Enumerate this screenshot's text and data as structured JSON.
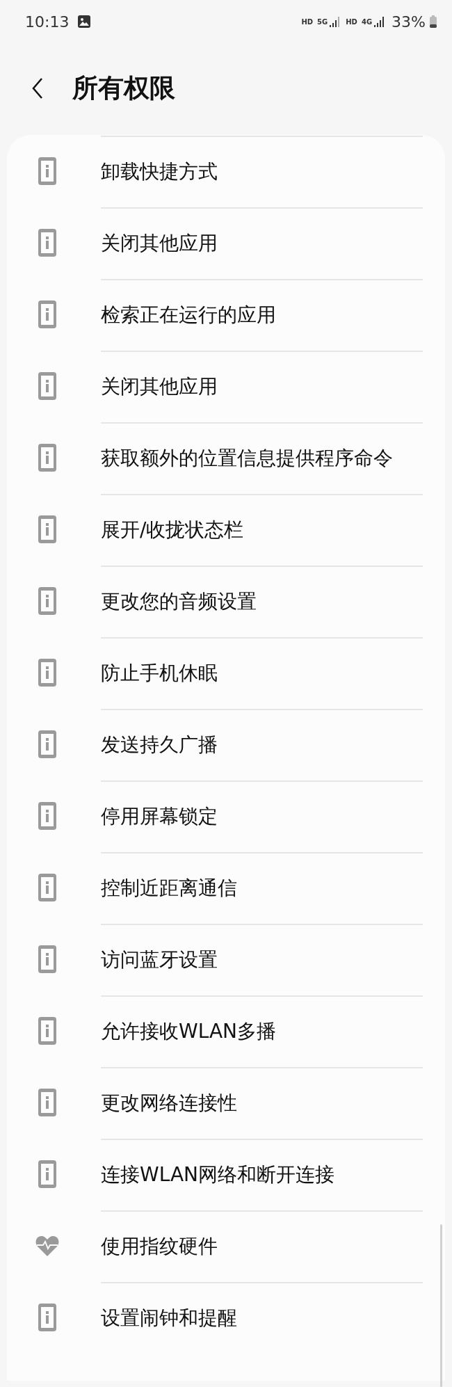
{
  "status_bar": {
    "time": "10:13",
    "sim1_hd": "HD",
    "sim1_network": "5G",
    "sim2_hd": "HD",
    "sim2_network": "4G",
    "battery": "33%"
  },
  "header": {
    "title": "所有权限"
  },
  "permissions": [
    {
      "kind": "info",
      "label": "卸载快捷方式"
    },
    {
      "kind": "info",
      "label": "关闭其他应用"
    },
    {
      "kind": "info",
      "label": "检索正在运行的应用"
    },
    {
      "kind": "info",
      "label": "关闭其他应用"
    },
    {
      "kind": "info",
      "label": "获取额外的位置信息提供程序命令"
    },
    {
      "kind": "info",
      "label": "展开/收拢状态栏"
    },
    {
      "kind": "info",
      "label": "更改您的音频设置"
    },
    {
      "kind": "info",
      "label": "防止手机休眠"
    },
    {
      "kind": "info",
      "label": "发送持久广播"
    },
    {
      "kind": "info",
      "label": "停用屏幕锁定"
    },
    {
      "kind": "info",
      "label": "控制近距离通信"
    },
    {
      "kind": "info",
      "label": "访问蓝牙设置"
    },
    {
      "kind": "info",
      "label": "允许接收WLAN多播"
    },
    {
      "kind": "info",
      "label": "更改网络连接性"
    },
    {
      "kind": "info",
      "label": "连接WLAN网络和断开连接"
    },
    {
      "kind": "health",
      "label": "使用指纹硬件"
    },
    {
      "kind": "info",
      "label": "设置闹钟和提醒"
    }
  ]
}
